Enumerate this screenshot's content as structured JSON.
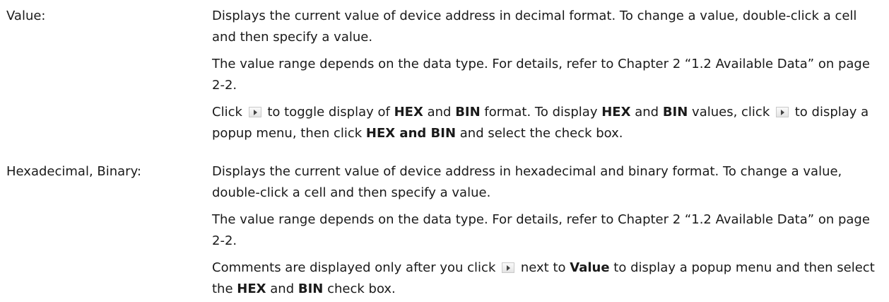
{
  "entries": [
    {
      "term": "Value:",
      "p1": "Displays the current value of device address in decimal format. To change a value, double-click a cell and then specify a value.",
      "p2": "The value range depends on the data type. For details, refer to Chapter 2 “1.2 Available Data” on page 2-2.",
      "p3": {
        "t1": "Click",
        "t2": "to toggle display of",
        "b1": "HEX",
        "t3": "and",
        "b2": "BIN",
        "t4": "format. To display",
        "b3": "HEX",
        "t5": "and",
        "b4": "BIN",
        "t6": "values, click",
        "t7": "to display a popup menu, then click",
        "b5": "HEX and BIN",
        "t8": "and select the check box."
      }
    },
    {
      "term": "Hexadecimal, Binary:",
      "p1": "Displays the current value of device address in hexadecimal and binary format. To change a value, double-click a cell and then specify a value.",
      "p2": "The value range depends on the data type. For details, refer to Chapter 2 “1.2 Available Data” on page 2-2.",
      "p3": {
        "t1": "Comments are displayed only after you click",
        "t2": "next to",
        "b1": "Value",
        "t3": "to display a popup menu and then select the",
        "b2": "HEX",
        "t4": "and",
        "b3": "BIN",
        "t5": "check box."
      }
    }
  ],
  "icons": {
    "expand_icon": "play-arrow-icon"
  }
}
